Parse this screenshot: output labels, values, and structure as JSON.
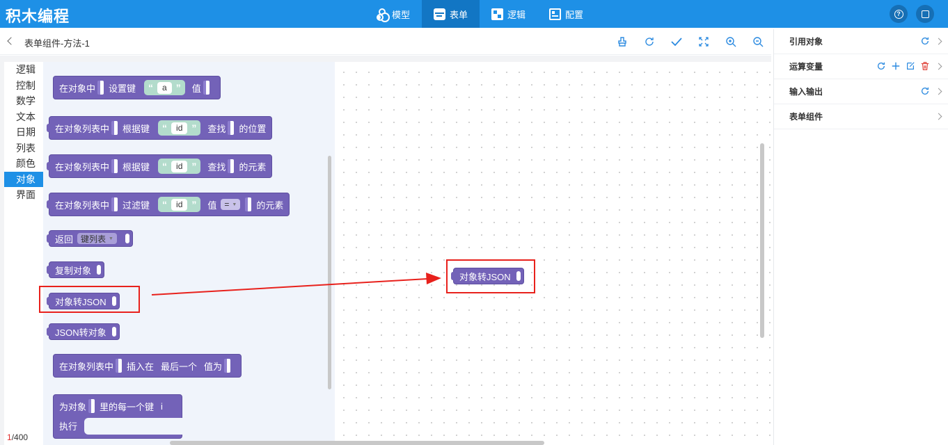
{
  "app": {
    "title": "积木编程"
  },
  "nav": {
    "items": [
      {
        "label": "模型",
        "icon": "model-icon"
      },
      {
        "label": "表单",
        "icon": "form-icon"
      },
      {
        "label": "逻辑",
        "icon": "logic-icon"
      },
      {
        "label": "配置",
        "icon": "config-icon"
      }
    ],
    "active_index": 1
  },
  "header_buttons": {
    "help": "?"
  },
  "breadcrumb": {
    "title": "表单组件-方法-1"
  },
  "toolbar": {
    "icons": [
      "clean-icon",
      "refresh-icon",
      "check-icon",
      "fit-icon",
      "zoom-in-icon",
      "zoom-out-icon"
    ]
  },
  "categories": {
    "items": [
      "逻辑",
      "控制",
      "数学",
      "文本",
      "日期",
      "列表",
      "颜色",
      "对象",
      "界面"
    ],
    "active": "对象"
  },
  "counter": {
    "current": "1",
    "total": "/400"
  },
  "blocks": {
    "b1": {
      "p1": "在对象中",
      "p2": "设置键",
      "str": "a",
      "p3": "值"
    },
    "b2": {
      "p1": "在对象列表中",
      "p2": "根据键",
      "str": "id",
      "p3": "查找",
      "p4": "的位置"
    },
    "b3": {
      "p1": "在对象列表中",
      "p2": "根据键",
      "str": "id",
      "p3": "查找",
      "p4": "的元素"
    },
    "b4": {
      "p1": "在对象列表中",
      "p2": "过滤键",
      "str": "id",
      "p3": "值",
      "op": "=",
      "p4": "的元素"
    },
    "b5": {
      "p1": "返回",
      "dd": "键列表"
    },
    "b6": {
      "p1": "复制对象"
    },
    "b7": {
      "p1": "对象转JSON"
    },
    "b8": {
      "p1": "JSON转对象"
    },
    "b9": {
      "p1": "在对象列表中",
      "p2": "插入在",
      "p3": "最后一个",
      "p4": "值为"
    },
    "b10": {
      "p1": "为对象",
      "p2": "里的每一个键",
      "var": "i",
      "p3": "执行"
    },
    "quote_open": "“",
    "quote_close": "”"
  },
  "canvas_block": {
    "label": "对象转JSON"
  },
  "annotation_colors": {
    "highlight": "#e8211c",
    "block": "#7362b8",
    "accent": "#1e90e6"
  },
  "right_panel": {
    "items": [
      {
        "label": "引用对象",
        "icons": [
          "refresh-icon"
        ]
      },
      {
        "label": "运算变量",
        "icons": [
          "refresh-icon",
          "plus-icon",
          "edit-icon",
          "trash-icon"
        ]
      },
      {
        "label": "输入输出",
        "icons": [
          "refresh-icon"
        ]
      },
      {
        "label": "表单组件",
        "icons": []
      }
    ]
  }
}
